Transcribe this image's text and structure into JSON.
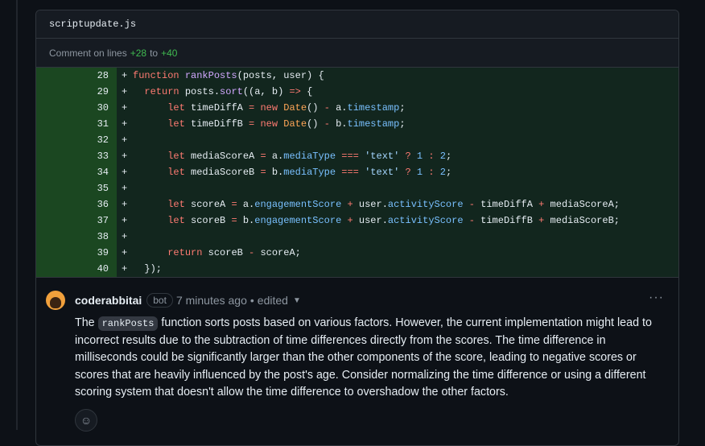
{
  "file": {
    "name": "scriptupdate.js"
  },
  "comment_on": {
    "prefix": "Comment on lines",
    "start": "+28",
    "to": "to",
    "end": "+40"
  },
  "diff": {
    "lines": [
      {
        "num": "28"
      },
      {
        "num": "29"
      },
      {
        "num": "30"
      },
      {
        "num": "31"
      },
      {
        "num": "32"
      },
      {
        "num": "33"
      },
      {
        "num": "34"
      },
      {
        "num": "35"
      },
      {
        "num": "36"
      },
      {
        "num": "37"
      },
      {
        "num": "38"
      },
      {
        "num": "39"
      },
      {
        "num": "40"
      }
    ]
  },
  "comment": {
    "author": "coderabbitai",
    "badge": "bot",
    "time": "7 minutes ago",
    "separator": "•",
    "edited": "edited",
    "menu": "···",
    "body_pre": "The ",
    "body_code": "rankPosts",
    "body_post": " function sorts posts based on various factors. However, the current implementation might lead to incorrect results due to the subtraction of time differences directly from the scores. The time difference in milliseconds could be significantly larger than the other components of the score, leading to negative scores or scores that are heavily influenced by the post's age. Consider normalizing the time difference or using a different scoring system that doesn't allow the time difference to overshadow the other factors."
  },
  "icons": {
    "avatar": "rabbit-avatar-icon",
    "caret": "chevron-down-icon",
    "reaction": "smiley-icon"
  },
  "colors": {
    "diff_add_bg": "#12261e",
    "line_number_bg": "#1b4721",
    "accent_green": "#3fb950"
  }
}
